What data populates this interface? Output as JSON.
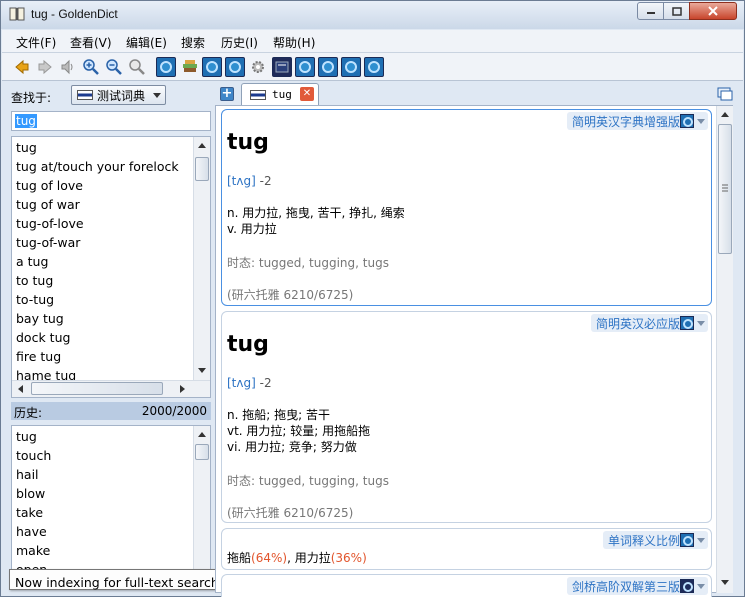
{
  "window": {
    "title": "tug - GoldenDict"
  },
  "menu": [
    "文件(F)",
    "查看(V)",
    "编辑(E)",
    "搜索",
    "历史(I)",
    "帮助(H)"
  ],
  "lookin": {
    "label": "查找于:",
    "group": "测试词典"
  },
  "search": {
    "value": "tug"
  },
  "wordlist": [
    "tug",
    "tug at/touch your forelock",
    "tug of love",
    "tug of war",
    "tug-of-love",
    "tug-of-war",
    "a tug",
    "to tug",
    "to-tug",
    "bay tug",
    "dock tug",
    "fire tug",
    "hame tug"
  ],
  "history": {
    "title": "历史:",
    "count": "2000/2000",
    "items": [
      "tug",
      "touch",
      "hail",
      "blow",
      "take",
      "have",
      "make",
      "open"
    ]
  },
  "tooltip": "Now indexing for full-text search: 简明英汉必应版",
  "tabs": [
    {
      "label": "tug"
    }
  ],
  "articles": [
    {
      "dict": "简明英汉字典增强版",
      "headword": "tug",
      "phonetic": "[tʌg]",
      "phonetic_num": " -2",
      "defs": [
        "n. 用力拉, 拖曳, 苦干, 挣扎, 绳索",
        "v. 用力拉"
      ],
      "tense": "时态: tugged, tugging, tugs",
      "freq": "(研六托雅 6210/6725)"
    },
    {
      "dict": "简明英汉必应版",
      "headword": "tug",
      "phonetic": "[tʌg]",
      "phonetic_num": " -2",
      "defs": [
        "n. 拖船; 拖曳; 苦干",
        "vt. 用力拉; 较量; 用拖船拖",
        "vi. 用力拉; 竞争; 努力做"
      ],
      "tense": "时态: tugged, tugging, tugs",
      "freq": "(研六托雅 6210/6725)"
    },
    {
      "dict": "单词释义比例",
      "ratio": {
        "w1": "拖船",
        "p1": "(64%)",
        "sep": ", ",
        "w2": "用力拉",
        "p2": "(36%)"
      }
    },
    {
      "dict": "剑桥高阶双解第三版"
    }
  ],
  "colors": {
    "accent": "#2d73c4",
    "percent": "#e2552c",
    "history_header": "#b9cbe2"
  }
}
